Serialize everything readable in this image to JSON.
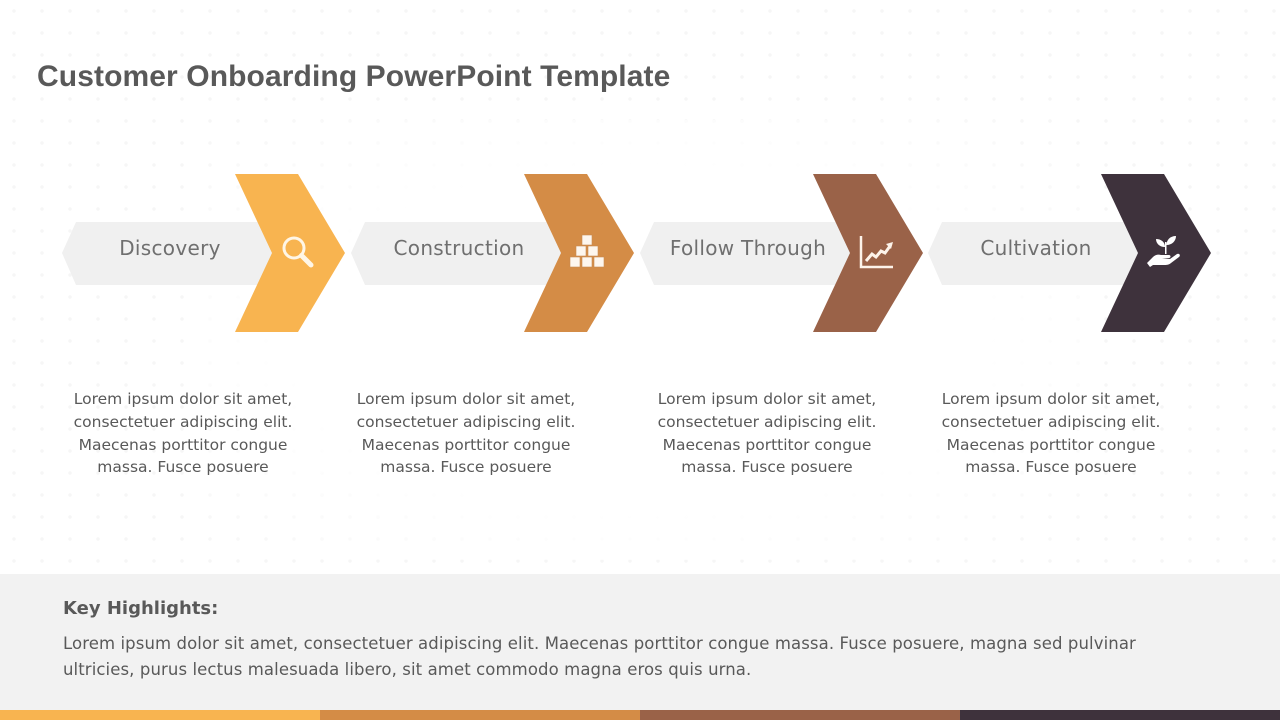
{
  "title": "Customer Onboarding PowerPoint Template",
  "steps": [
    {
      "label": "Discovery",
      "icon": "magnifier-icon",
      "color": "#F8B450",
      "description": "Lorem ipsum dolor sit amet, consectetuer adipiscing elit. Maecenas porttitor congue massa. Fusce posuere"
    },
    {
      "label": "Construction",
      "icon": "building-blocks-icon",
      "color": "#D48C46",
      "description": "Lorem ipsum dolor sit amet, consectetuer adipiscing elit. Maecenas porttitor congue massa. Fusce posuere"
    },
    {
      "label": "Follow Through",
      "icon": "growth-chart-icon",
      "color": "#9A6248",
      "description": "Lorem ipsum dolor sit amet, consectetuer adipiscing elit. Maecenas porttitor congue massa. Fusce posuere"
    },
    {
      "label": "Cultivation",
      "icon": "plant-in-hand-icon",
      "color": "#3E323C",
      "description": "Lorem ipsum dolor sit amet, consectetuer adipiscing elit. Maecenas porttitor congue massa. Fusce posuere"
    }
  ],
  "highlights": {
    "title": "Key Highlights:",
    "body": "Lorem ipsum dolor sit amet, consectetuer  adipiscing elit. Maecenas porttitor congue massa. Fusce posuere,  magna sed pulvinar ultricies, purus lectus malesuada libero, sit amet commodo magna eros quis urna."
  },
  "colors": {
    "pill": "#F0F0F0",
    "text": "#595959",
    "highlights_bg": "#F2F2F2"
  }
}
